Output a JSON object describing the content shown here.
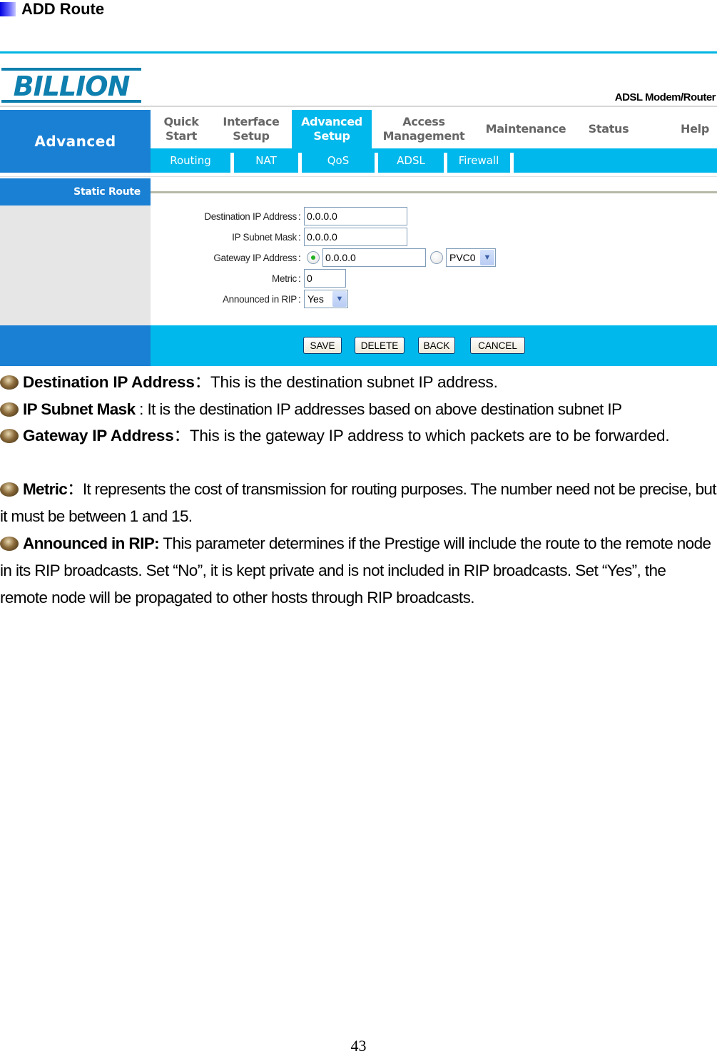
{
  "section": {
    "title": "ADD Route"
  },
  "router": {
    "brand": "BILLION",
    "product": "ADSL Modem/Router",
    "side_section": "Advanced",
    "side_page": "Static Route",
    "menu": [
      {
        "label": "Quick\nStart",
        "active": false
      },
      {
        "label": "Interface\nSetup",
        "active": false
      },
      {
        "label": "Advanced\nSetup",
        "active": true
      },
      {
        "label": "Access\nManagement",
        "active": false
      },
      {
        "label": "Maintenance",
        "active": false
      },
      {
        "label": "Status",
        "active": false
      },
      {
        "label": "Help",
        "active": false
      }
    ],
    "submenu": [
      "Routing",
      "NAT",
      "QoS",
      "ADSL",
      "Firewall"
    ],
    "form": {
      "destination_ip": {
        "label": "Destination IP Address",
        "value": "0.0.0.0"
      },
      "subnet_mask": {
        "label": "IP Subnet Mask",
        "value": "0.0.0.0"
      },
      "gateway_ip": {
        "label": "Gateway IP Address",
        "value": "0.0.0.0",
        "selected_option": "ip",
        "pvc_value": "PVC0"
      },
      "metric": {
        "label": "Metric",
        "value": "0"
      },
      "announced_rip": {
        "label": "Announced in RIP",
        "value": "Yes"
      }
    },
    "buttons": {
      "save": "SAVE",
      "delete": "DELETE",
      "back": "BACK",
      "cancel": "CANCEL"
    }
  },
  "descriptions": [
    {
      "term": "Destination IP Address",
      "sep": "：",
      "text": "This is the destination subnet IP address."
    },
    {
      "term": "IP Subnet Mask",
      "sep": " : ",
      "text": "It is the destination IP addresses based on above destination subnet IP"
    },
    {
      "term": "Gateway IP Address",
      "sep": "：",
      "text": "This is the gateway IP address to which packets are to be forwarded."
    },
    {
      "term": "Metric",
      "sep": "：",
      "text": "It represents the cost of transmission for routing purposes. The number need not be precise, but it must be between 1 and 15."
    },
    {
      "term": "Announced in RIP:",
      "sep": " ",
      "text": "This parameter determines if the Prestige will include the route to the remote node in its RIP broadcasts. Set “No”, it is kept private and is not included in RIP broadcasts. Set “Yes”, the remote node will be propagated to other hosts through RIP broadcasts."
    }
  ],
  "page_number": "43"
}
